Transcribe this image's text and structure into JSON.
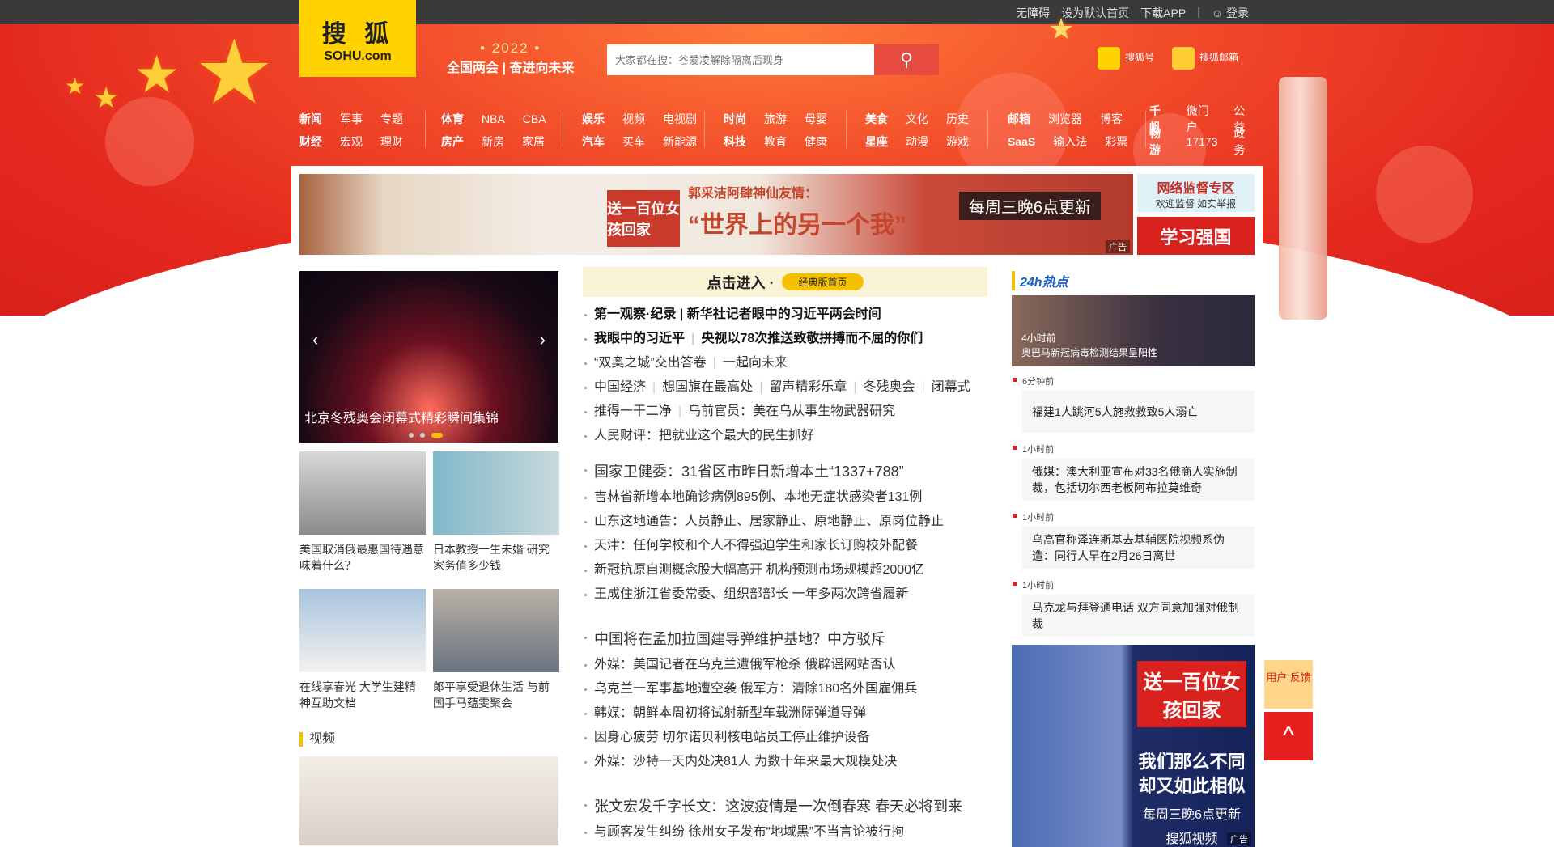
{
  "topbar": {
    "accessibility": "无障碍",
    "set_home": "设为默认首页",
    "download_app": "下载APP",
    "login": "登录"
  },
  "logo": {
    "cn": "搜  狐",
    "en": "SOHU.com"
  },
  "slogan": {
    "year": "• 2022 •",
    "line": "全国两会 | 奋进向未来"
  },
  "search": {
    "placeholder": "大家都在搜：谷爱凌解除隔离后现身"
  },
  "header_links": {
    "sohuhao": "搜狐号",
    "mail": "搜狐邮箱"
  },
  "nav": [
    {
      "rows": [
        [
          "新闻",
          "军事",
          "专题"
        ],
        [
          "财经",
          "宏观",
          "理财"
        ]
      ]
    },
    {
      "rows": [
        [
          "体育",
          "NBA",
          "CBA"
        ],
        [
          "房产",
          "新房",
          "家居"
        ]
      ]
    },
    {
      "rows": [
        [
          "娱乐",
          "视频",
          "电视剧"
        ],
        [
          "汽车",
          "买车",
          "新能源"
        ]
      ]
    },
    {
      "rows": [
        [
          "时尚",
          "旅游",
          "母婴"
        ],
        [
          "科技",
          "教育",
          "健康"
        ]
      ]
    },
    {
      "rows": [
        [
          "美食",
          "文化",
          "历史"
        ],
        [
          "星座",
          "动漫",
          "游戏"
        ]
      ]
    },
    {
      "rows": [
        [
          "邮箱",
          "浏览器",
          "博客"
        ],
        [
          "SaaS",
          "输入法",
          "彩票"
        ]
      ]
    },
    {
      "rows": [
        [
          "千帆",
          "微门户",
          "公益"
        ],
        [
          "畅游",
          "17173",
          "政务"
        ]
      ]
    }
  ],
  "banner": {
    "badge": "送一百位女孩回家",
    "t1": "郭采洁阿肆神仙友情：",
    "t2": "“世界上的另一个我”",
    "t3": "每周三晚6点更新",
    "ad": "广告"
  },
  "side_ads": {
    "a1_title": "网络监督专区",
    "a1_sub": "欢迎监督  如实举报",
    "a2": "学习强国"
  },
  "slider": {
    "caption": "北京冬残奥会闭幕式精彩瞬间集锦",
    "prev": "‹",
    "next": "›"
  },
  "thumbs": [
    {
      "title": "美国取消俄最惠国待遇意味着什么？"
    },
    {
      "title": "日本教授一生未婚 研究家务值多少钱"
    },
    {
      "title": "在线享春光 大学生建精神互助文档"
    },
    {
      "title": "郎平享受退休生活 与前国手马蕴雯聚会"
    }
  ],
  "video_section": "视频",
  "enter": {
    "text": "点击进入 ·",
    "btn": "经典版首页"
  },
  "news_groups": [
    [
      {
        "parts": [
          "第一观察·纪录 | 新华社记者眼中的习近平两会时间"
        ],
        "bold": true
      },
      {
        "parts": [
          "我眼中的习近平",
          "央视以78次推送致敬拼搏而不屈的你们"
        ],
        "bold": true
      },
      {
        "parts": [
          "“双奥之城”交出答卷",
          "一起向未来"
        ]
      },
      {
        "parts": [
          "中国经济",
          "想国旗在最高处",
          "留声精彩乐章",
          "冬残奥会",
          "闭幕式"
        ]
      },
      {
        "parts": [
          "推得一干二净",
          "乌前官员：美在乌从事生物武器研究"
        ]
      },
      {
        "parts": [
          "人民财评：把就业这个最大的民生抓好"
        ]
      }
    ],
    [
      {
        "parts": [
          "国家卫健委：31省区市昨日新增本土“1337+788”"
        ],
        "big": true
      },
      {
        "parts": [
          "吉林省新增本地确诊病例895例、本地无症状感染者131例"
        ]
      },
      {
        "parts": [
          "山东这地通告：人员静止、居家静止、原地静止、原岗位静止"
        ]
      },
      {
        "parts": [
          "天津：任何学校和个人不得强迫学生和家长订购校外配餐"
        ]
      },
      {
        "parts": [
          "新冠抗原自测概念股大幅高开 机构预测市场规模超2000亿"
        ]
      },
      {
        "parts": [
          "王成住浙江省委常委、组织部部长 一年多两次跨省履新"
        ]
      }
    ],
    [
      {
        "parts": [
          "中国将在孟加拉国建导弹维护基地？中方驳斥"
        ],
        "big": true
      },
      {
        "parts": [
          "外媒：美国记者在乌克兰遭俄军枪杀 俄辟谣网站否认"
        ]
      },
      {
        "parts": [
          "乌克兰一军事基地遭空袭 俄军方：清除180名外国雇佣兵"
        ]
      },
      {
        "parts": [
          "韩媒：朝鲜本周初将试射新型车载洲际弹道导弹"
        ]
      },
      {
        "parts": [
          "因身心疲劳 切尔诺贝利核电站员工停止维护设备"
        ]
      },
      {
        "parts": [
          "外媒：沙特一天内处决81人 为数十年来最大规模处决"
        ]
      }
    ],
    [
      {
        "parts": [
          "张文宏发千字长文：这波疫情是一次倒春寒 春天必将到来"
        ],
        "big": true
      },
      {
        "parts": [
          "与顾客发生纠纷 徐州女子发布“地域黑”不当言论被行拘"
        ]
      }
    ]
  ],
  "hot": {
    "heading": "24h热点",
    "top": {
      "time": "4小时前",
      "title": "奥巴马新冠病毒检测结果呈阳性"
    },
    "items": [
      {
        "time": "6分钟前",
        "title": "福建1人跳河5人施救救致5人溺亡"
      },
      {
        "time": "1小时前",
        "title": "俄媒：澳大利亚宣布对33名俄商人实施制裁，包括切尔西老板阿布拉莫维奇"
      },
      {
        "time": "1小时前",
        "title": "乌高官称泽连斯基去基辅医院视频系伪造：同行人早在2月26日离世"
      },
      {
        "time": "1小时前",
        "title": "马克龙与拜登通电话 双方同意加强对俄制裁"
      }
    ]
  },
  "ad3": {
    "a": "送一百位女孩回家",
    "b": "我们那么不同 却又如此相似",
    "c": "每周三晚6点更新",
    "d": "搜狐视频",
    "ad": "广告"
  },
  "float": {
    "feedback": "用户 反馈",
    "top": "^"
  }
}
